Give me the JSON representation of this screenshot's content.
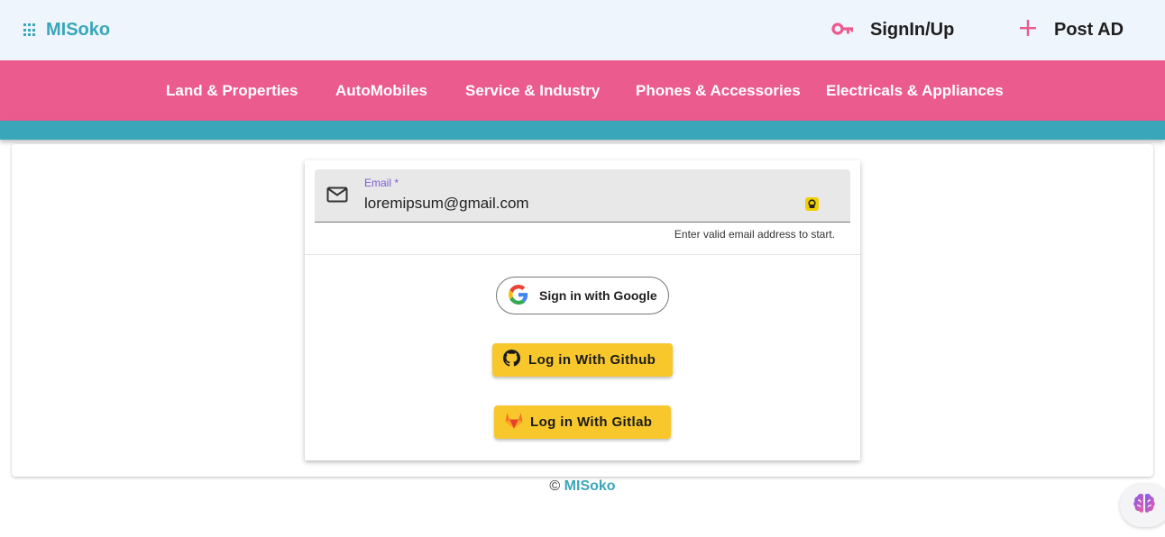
{
  "header": {
    "brand": "MISoko",
    "signin_label": "SignIn/Up",
    "postad_label": "Post AD",
    "brand_color": "#3aa6b9",
    "accent_color": "#ec5b8e"
  },
  "categories": [
    "Land & Properties",
    "AutoMobiles",
    "Service & Industry",
    "Phones & Accessories",
    "Electricals & Appliances"
  ],
  "login": {
    "email_label": "Email *",
    "email_value": "loremipsum@gmail.com",
    "email_helper": "Enter valid email address to start.",
    "google_button": "Sign in with Google",
    "github_button": "Log in With Github",
    "gitlab_button": "Log in With Gitlab"
  },
  "footer": {
    "copyright_symbol": "©",
    "brand": "MISoko"
  },
  "icons": {
    "apps": "apps-grid-icon",
    "signin": "key-icon",
    "postad": "plus-icon",
    "email": "mail-icon",
    "password_manager": "password-manager-icon",
    "google": "google-logo-icon",
    "github": "github-logo-icon",
    "gitlab": "gitlab-logo-icon",
    "assistant": "brain-icon"
  }
}
